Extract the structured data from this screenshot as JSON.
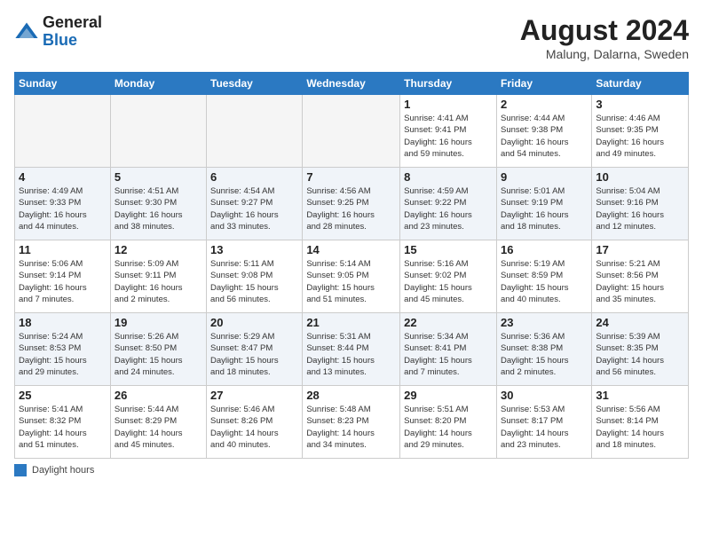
{
  "header": {
    "logo_line1": "General",
    "logo_line2": "Blue",
    "month_year": "August 2024",
    "location": "Malung, Dalarna, Sweden"
  },
  "days_of_week": [
    "Sunday",
    "Monday",
    "Tuesday",
    "Wednesday",
    "Thursday",
    "Friday",
    "Saturday"
  ],
  "weeks": [
    [
      {
        "day": "",
        "info": ""
      },
      {
        "day": "",
        "info": ""
      },
      {
        "day": "",
        "info": ""
      },
      {
        "day": "",
        "info": ""
      },
      {
        "day": "1",
        "info": "Sunrise: 4:41 AM\nSunset: 9:41 PM\nDaylight: 16 hours\nand 59 minutes."
      },
      {
        "day": "2",
        "info": "Sunrise: 4:44 AM\nSunset: 9:38 PM\nDaylight: 16 hours\nand 54 minutes."
      },
      {
        "day": "3",
        "info": "Sunrise: 4:46 AM\nSunset: 9:35 PM\nDaylight: 16 hours\nand 49 minutes."
      }
    ],
    [
      {
        "day": "4",
        "info": "Sunrise: 4:49 AM\nSunset: 9:33 PM\nDaylight: 16 hours\nand 44 minutes."
      },
      {
        "day": "5",
        "info": "Sunrise: 4:51 AM\nSunset: 9:30 PM\nDaylight: 16 hours\nand 38 minutes."
      },
      {
        "day": "6",
        "info": "Sunrise: 4:54 AM\nSunset: 9:27 PM\nDaylight: 16 hours\nand 33 minutes."
      },
      {
        "day": "7",
        "info": "Sunrise: 4:56 AM\nSunset: 9:25 PM\nDaylight: 16 hours\nand 28 minutes."
      },
      {
        "day": "8",
        "info": "Sunrise: 4:59 AM\nSunset: 9:22 PM\nDaylight: 16 hours\nand 23 minutes."
      },
      {
        "day": "9",
        "info": "Sunrise: 5:01 AM\nSunset: 9:19 PM\nDaylight: 16 hours\nand 18 minutes."
      },
      {
        "day": "10",
        "info": "Sunrise: 5:04 AM\nSunset: 9:16 PM\nDaylight: 16 hours\nand 12 minutes."
      }
    ],
    [
      {
        "day": "11",
        "info": "Sunrise: 5:06 AM\nSunset: 9:14 PM\nDaylight: 16 hours\nand 7 minutes."
      },
      {
        "day": "12",
        "info": "Sunrise: 5:09 AM\nSunset: 9:11 PM\nDaylight: 16 hours\nand 2 minutes."
      },
      {
        "day": "13",
        "info": "Sunrise: 5:11 AM\nSunset: 9:08 PM\nDaylight: 15 hours\nand 56 minutes."
      },
      {
        "day": "14",
        "info": "Sunrise: 5:14 AM\nSunset: 9:05 PM\nDaylight: 15 hours\nand 51 minutes."
      },
      {
        "day": "15",
        "info": "Sunrise: 5:16 AM\nSunset: 9:02 PM\nDaylight: 15 hours\nand 45 minutes."
      },
      {
        "day": "16",
        "info": "Sunrise: 5:19 AM\nSunset: 8:59 PM\nDaylight: 15 hours\nand 40 minutes."
      },
      {
        "day": "17",
        "info": "Sunrise: 5:21 AM\nSunset: 8:56 PM\nDaylight: 15 hours\nand 35 minutes."
      }
    ],
    [
      {
        "day": "18",
        "info": "Sunrise: 5:24 AM\nSunset: 8:53 PM\nDaylight: 15 hours\nand 29 minutes."
      },
      {
        "day": "19",
        "info": "Sunrise: 5:26 AM\nSunset: 8:50 PM\nDaylight: 15 hours\nand 24 minutes."
      },
      {
        "day": "20",
        "info": "Sunrise: 5:29 AM\nSunset: 8:47 PM\nDaylight: 15 hours\nand 18 minutes."
      },
      {
        "day": "21",
        "info": "Sunrise: 5:31 AM\nSunset: 8:44 PM\nDaylight: 15 hours\nand 13 minutes."
      },
      {
        "day": "22",
        "info": "Sunrise: 5:34 AM\nSunset: 8:41 PM\nDaylight: 15 hours\nand 7 minutes."
      },
      {
        "day": "23",
        "info": "Sunrise: 5:36 AM\nSunset: 8:38 PM\nDaylight: 15 hours\nand 2 minutes."
      },
      {
        "day": "24",
        "info": "Sunrise: 5:39 AM\nSunset: 8:35 PM\nDaylight: 14 hours\nand 56 minutes."
      }
    ],
    [
      {
        "day": "25",
        "info": "Sunrise: 5:41 AM\nSunset: 8:32 PM\nDaylight: 14 hours\nand 51 minutes."
      },
      {
        "day": "26",
        "info": "Sunrise: 5:44 AM\nSunset: 8:29 PM\nDaylight: 14 hours\nand 45 minutes."
      },
      {
        "day": "27",
        "info": "Sunrise: 5:46 AM\nSunset: 8:26 PM\nDaylight: 14 hours\nand 40 minutes."
      },
      {
        "day": "28",
        "info": "Sunrise: 5:48 AM\nSunset: 8:23 PM\nDaylight: 14 hours\nand 34 minutes."
      },
      {
        "day": "29",
        "info": "Sunrise: 5:51 AM\nSunset: 8:20 PM\nDaylight: 14 hours\nand 29 minutes."
      },
      {
        "day": "30",
        "info": "Sunrise: 5:53 AM\nSunset: 8:17 PM\nDaylight: 14 hours\nand 23 minutes."
      },
      {
        "day": "31",
        "info": "Sunrise: 5:56 AM\nSunset: 8:14 PM\nDaylight: 14 hours\nand 18 minutes."
      }
    ]
  ],
  "footer": {
    "legend_label": "Daylight hours"
  }
}
